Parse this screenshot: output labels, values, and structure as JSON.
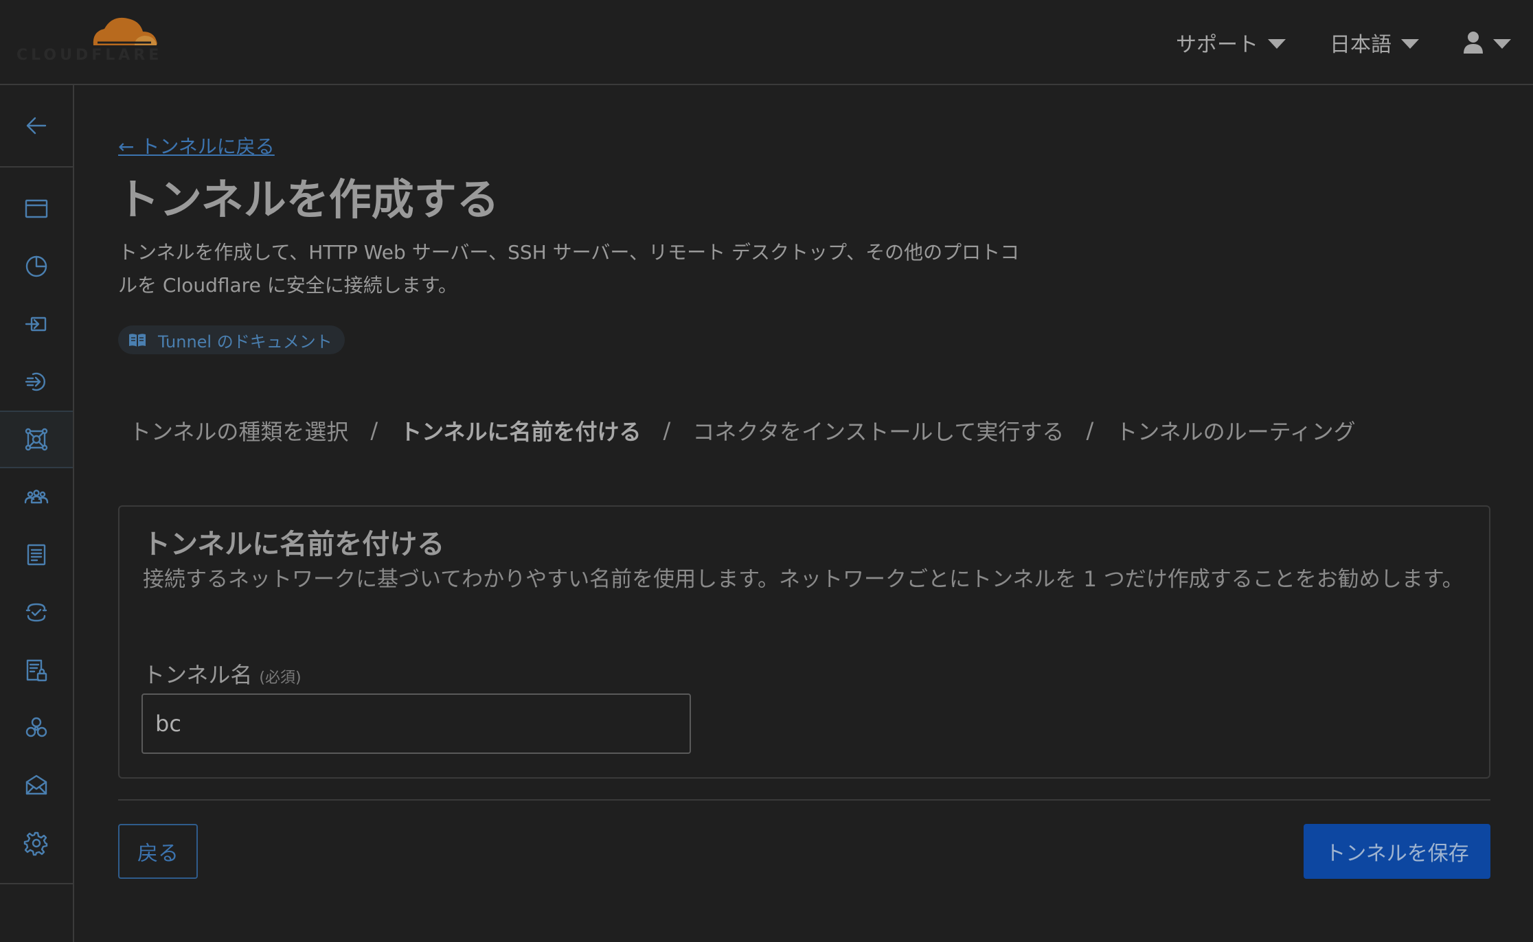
{
  "header": {
    "logo_text": "CLOUDFLARE",
    "support_label": "サポート",
    "language_label": "日本語",
    "user_icon": "user-icon"
  },
  "sidebar": {
    "back_icon": "arrow-left-icon",
    "items": [
      {
        "icon": "browser-window-icon"
      },
      {
        "icon": "pie-chart-icon"
      },
      {
        "icon": "gateway-icon"
      },
      {
        "icon": "access-login-icon"
      },
      {
        "icon": "network-icon",
        "active": true
      },
      {
        "icon": "team-icon"
      },
      {
        "icon": "logs-icon"
      },
      {
        "icon": "dex-monitoring-icon"
      },
      {
        "icon": "secure-document-icon"
      },
      {
        "icon": "integrations-icon"
      },
      {
        "icon": "email-security-icon"
      },
      {
        "icon": "settings-icon"
      }
    ]
  },
  "main": {
    "back_link": "← トンネルに戻る",
    "title": "トンネルを作成する",
    "description": "トンネルを作成して、HTTP Web サーバー、SSH サーバー、リモート デスクトップ、その他のプロトコルを Cloudflare に安全に接続します。",
    "doc_link": "Tunnel のドキュメント",
    "steps": [
      {
        "label": "トンネルの種類を選択",
        "current": false
      },
      {
        "label": "トンネルに名前を付ける",
        "current": true
      },
      {
        "label": "コネクタをインストールして実行する",
        "current": false
      },
      {
        "label": "トンネルのルーティング",
        "current": false
      }
    ],
    "step_separator": "/",
    "card": {
      "title": "トンネルに名前を付ける",
      "description": "接続するネットワークに基づいてわかりやすい名前を使用します。ネットワークごとにトンネルを 1 つだけ作成することをお勧めします。",
      "field_label": "トンネル名",
      "field_required": "(必須)",
      "field_value": "bc"
    },
    "back_button": "戻る",
    "save_button": "トンネルを保存"
  },
  "colors": {
    "background": "#1f1f1f",
    "accent": "#4a7fb0",
    "primary_button": "#0d47a1",
    "logo_orange": "#b86a1e"
  }
}
